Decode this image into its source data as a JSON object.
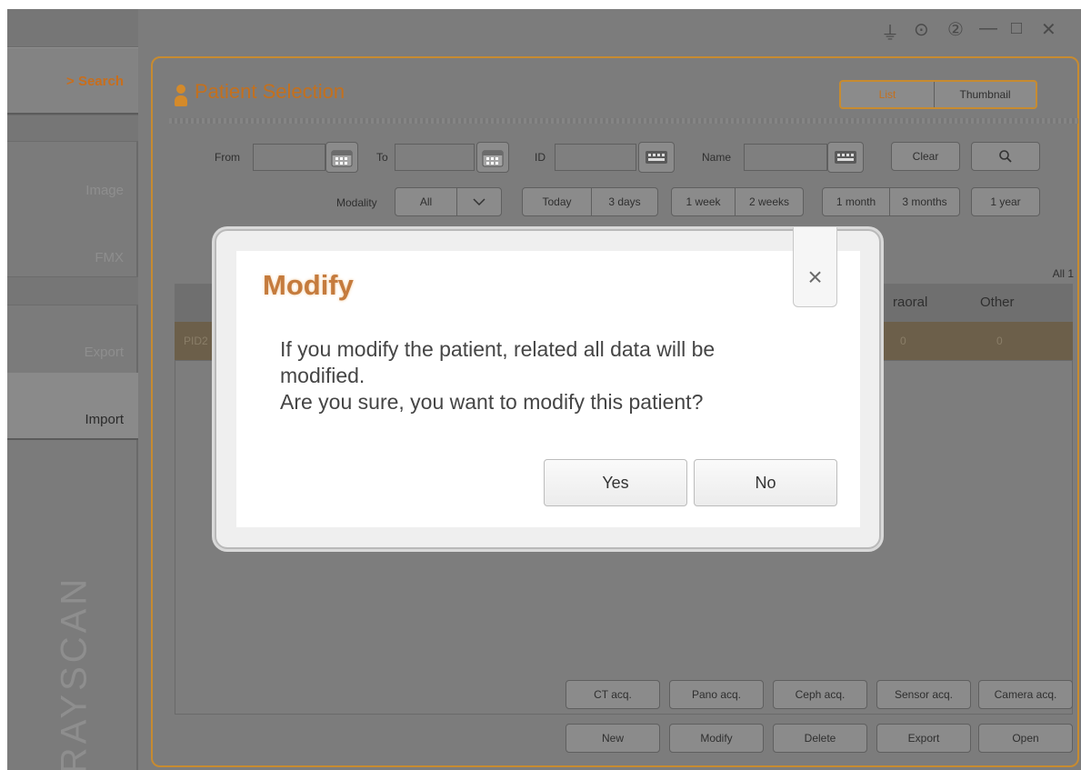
{
  "window": {
    "controls": [
      "⏚",
      "⚙",
      "?",
      "—",
      "□",
      "×"
    ]
  },
  "sidebar": {
    "items": [
      {
        "label": "> Search"
      },
      {
        "label": "Image"
      },
      {
        "label": "FMX"
      },
      {
        "label": "Export"
      },
      {
        "label": "Import"
      }
    ],
    "brand": "RAYSCAN"
  },
  "page": {
    "title": "Patient Selection",
    "view_toggle": [
      "List",
      "Thumbnail"
    ],
    "filters": {
      "from_label": "From",
      "to_label": "To",
      "id_label": "ID",
      "name_label": "Name",
      "clear_label": "Clear",
      "modality_label": "Modality",
      "modality_value": "All",
      "range_group_1": [
        "Today",
        "3 days"
      ],
      "range_group_2": [
        "1 week",
        "2 weeks"
      ],
      "range_group_3": [
        "1 month",
        "3 months"
      ],
      "range_1year": "1 year"
    },
    "count_label": "All 1",
    "table": {
      "headers_visible": [
        "raoral",
        "Other"
      ],
      "row": {
        "id_prefix": "PID2",
        "intraoral": "0",
        "other": "0"
      }
    },
    "bottom_buttons": {
      "row1": [
        "CT acq.",
        "Pano acq.",
        "Ceph acq.",
        "Sensor acq.",
        "Camera acq."
      ],
      "row2": [
        "New",
        "Modify",
        "Delete",
        "Export",
        "Open"
      ]
    }
  },
  "dialog": {
    "title": "Modify",
    "lines": [
      "If you modify the patient, related all data will be",
      "modified.",
      "Are you sure, you want to modify this patient?"
    ],
    "yes_label": "Yes",
    "no_label": "No",
    "close_icon": "×"
  }
}
